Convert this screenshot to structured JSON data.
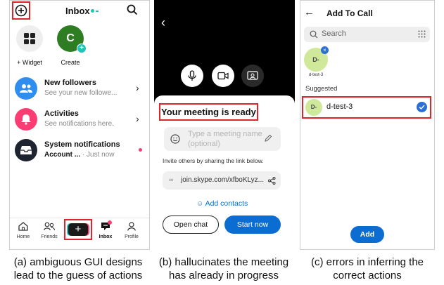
{
  "panel_a": {
    "header": {
      "title": "Inbox"
    },
    "stories": [
      {
        "label": "+ Widget"
      },
      {
        "label": "Create",
        "avatar_letter": "C"
      }
    ],
    "rows": [
      {
        "title": "New followers",
        "subtitle": "See your new followe...",
        "icon": "people-icon"
      },
      {
        "title": "Activities",
        "subtitle": "See notifications here.",
        "icon": "bell-icon"
      },
      {
        "title": "System notifications",
        "subtitle_bold": "Account ...",
        "subtitle_time": " · Just now",
        "icon": "inbox-tray-icon"
      }
    ],
    "nav": [
      {
        "label": "Home"
      },
      {
        "label": "Friends"
      },
      {
        "label": ""
      },
      {
        "label": "Inbox"
      },
      {
        "label": "Profile"
      }
    ],
    "colors": {
      "teal": "#23c3b8",
      "green": "#2f7d22",
      "follow_blue": "#2f8df0",
      "activity_pink": "#fb3d73",
      "sys_navy": "#1e2330",
      "accent_red": "#e0242a"
    }
  },
  "panel_b": {
    "heading": "Your meeting is ready!",
    "meeting_name_placeholder": "Type a meeting name (optional)",
    "invite_text": "Invite others by sharing the link below.",
    "link": "join.skype.com/xfboKLyz...",
    "add_contacts": "Add contacts",
    "open_chat": "Open chat",
    "start_now": "Start now",
    "colors": {
      "blue": "#0b6cd1"
    }
  },
  "panel_c": {
    "title": "Add To Call",
    "search_placeholder": "Search",
    "selected_chip": {
      "avatar": "D-",
      "label": "d-test-3"
    },
    "section_label": "Suggested",
    "suggested": [
      {
        "avatar": "D-",
        "name": "d-test-3",
        "checked": true
      }
    ],
    "add_button": "Add",
    "colors": {
      "avatar_bg": "#cfe89a",
      "check_blue": "#2a6fd8"
    }
  },
  "captions": {
    "a": [
      "(a) ambiguous GUI designs",
      "lead to the guess of actions"
    ],
    "b": [
      "(b) hallucinates the meeting",
      "has already in progress"
    ],
    "c": [
      "(c) errors in inferring the",
      "correct actions"
    ]
  }
}
